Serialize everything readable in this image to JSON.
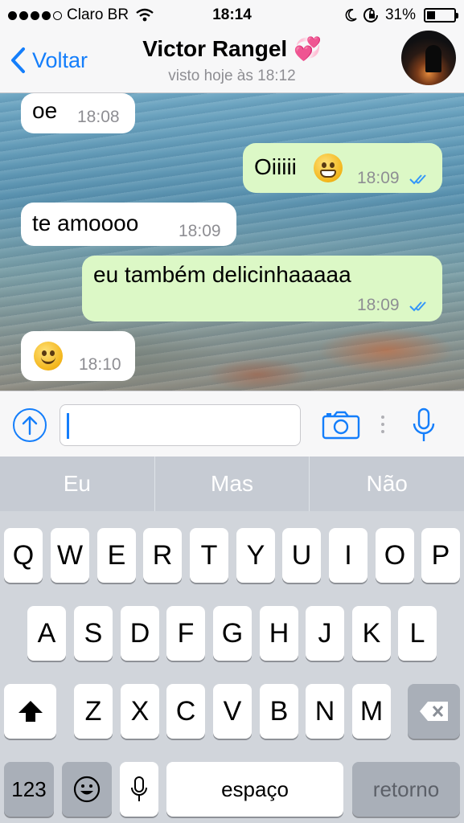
{
  "status_bar": {
    "carrier": "Claro BR",
    "time": "18:14",
    "battery": "31%",
    "battery_level": 0.31,
    "signal_bars": 4
  },
  "header": {
    "back_label": "Voltar",
    "contact_name": "Victor Rangel 💞",
    "last_seen": "visto hoje às 18:12"
  },
  "messages": [
    {
      "direction": "in",
      "text": "oe",
      "time": "18:08"
    },
    {
      "direction": "out",
      "text": "Oiiiii",
      "emoji": "grinning-face",
      "time": "18:09",
      "read": true
    },
    {
      "direction": "in",
      "text": "te amoooo",
      "time": "18:09"
    },
    {
      "direction": "out",
      "text": "eu também delicinhaaaaa",
      "time": "18:09",
      "read": true
    },
    {
      "direction": "in",
      "text": "",
      "emoji": "smiling-face",
      "time": "18:10"
    }
  ],
  "input": {
    "value": "",
    "placeholder": ""
  },
  "suggestions": [
    "Eu",
    "Mas",
    "Não"
  ],
  "keyboard": {
    "row1": [
      "Q",
      "W",
      "E",
      "R",
      "T",
      "Y",
      "U",
      "I",
      "O",
      "P"
    ],
    "row2": [
      "A",
      "S",
      "D",
      "F",
      "G",
      "H",
      "J",
      "K",
      "L"
    ],
    "row3": [
      "Z",
      "X",
      "C",
      "V",
      "B",
      "N",
      "M"
    ],
    "numbers_label": "123",
    "space_label": "espaço",
    "return_label": "retorno"
  },
  "colors": {
    "accent": "#147efb",
    "bubble_out": "#dcf8c6",
    "bubble_in": "#ffffff"
  }
}
